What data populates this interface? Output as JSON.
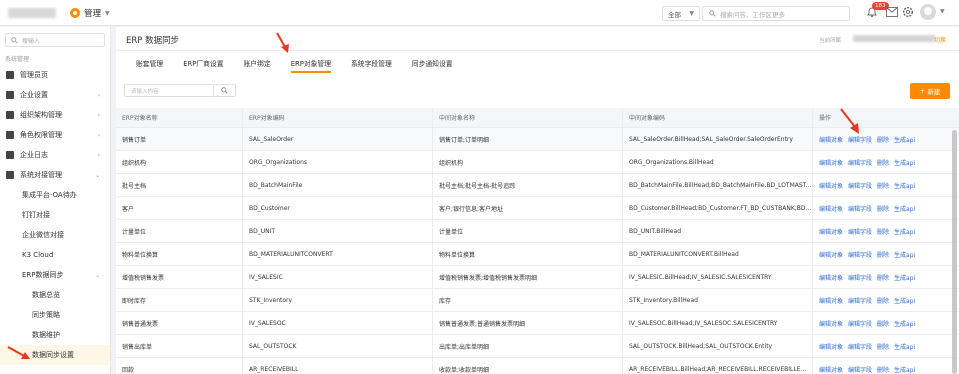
{
  "topbar": {
    "app_name": "管理",
    "search_scope": "全部",
    "search_placeholder": "搜索问答、工作区更多",
    "notification_count": "183"
  },
  "sidebar": {
    "search_placeholder": "搜输入",
    "section_label": "系统管理",
    "items": [
      {
        "label": "管理员页"
      },
      {
        "label": "企业设置"
      },
      {
        "label": "组织架构管理"
      },
      {
        "label": "角色权限管理"
      },
      {
        "label": "企业日志"
      },
      {
        "label": "系统对接管理"
      },
      {
        "label": "集成平台-OA待办"
      },
      {
        "label": "钉钉对接"
      },
      {
        "label": "企业微信对接"
      },
      {
        "label": "K3 Cloud"
      },
      {
        "label": "ERP数据同步"
      },
      {
        "label": "数据总览"
      },
      {
        "label": "同步策略"
      },
      {
        "label": "数据维护"
      },
      {
        "label": "数据同步设置"
      }
    ]
  },
  "main": {
    "title": "ERP 数据同步",
    "current_label": "当前所属",
    "switch_label": "切换",
    "tabs": [
      {
        "label": "账套管理"
      },
      {
        "label": "ERP厂商设置"
      },
      {
        "label": "账户绑定"
      },
      {
        "label": "ERP对象管理"
      },
      {
        "label": "系统字段管理"
      },
      {
        "label": "同步通知设置"
      }
    ],
    "filter_placeholder": "请输入内容",
    "add_button": "新建"
  },
  "table": {
    "headers": [
      "ERP对象名称",
      "ERP对象编码",
      "中间对象名称",
      "中间对象编码",
      "操作"
    ],
    "actions": [
      "编辑对象",
      "编辑字段",
      "删除",
      "生成api"
    ],
    "rows": [
      [
        "销售订单",
        "SAL_SaleOrder",
        "销售订单;订单明细",
        "SAL_SaleOrder.BillHead;SAL_SaleOrder.SaleOrderEntry"
      ],
      [
        "组织机构",
        "ORG_Organizations",
        "组织机构",
        "ORG_Organizations.BillHead"
      ],
      [
        "批号主档",
        "BD_BatchMainFile",
        "批号主档;批号主档-批号追踪",
        "BD_BatchMainFile.BillHead;BD_BatchMainFile.BD_LOTMAST..."
      ],
      [
        "客户",
        "BD_Customer",
        "客户;银行信息;客户地址",
        "BD_Customer.BillHead;BD_Customer.FT_BD_CUSTBANK;BD..."
      ],
      [
        "计量单位",
        "BD_UNIT",
        "计量单位",
        "BD_UNIT.BillHead"
      ],
      [
        "物料单位换算",
        "BD_MATERIALUNITCONVERT",
        "物料单位换算",
        "BD_MATERIALUNITCONVERT.BillHead"
      ],
      [
        "增值税销售发票",
        "IV_SALESIC",
        "增值税销售发票;增值税销售发票明细",
        "IV_SALESIC.BillHead;IV_SALESIC.SALESICENTRY"
      ],
      [
        "即时库存",
        "STK_Inventory",
        "库存",
        "STK_Inventory.BillHead"
      ],
      [
        "销售普通发票",
        "IV_SALESOC",
        "销售普通发票;普通销售发票明细",
        "IV_SALESOC.BillHead;IV_SALESOC.SALESICENTRY"
      ],
      [
        "销售出库单",
        "SAL_OUTSTOCK",
        "出库单;出库单明细",
        "SAL_OUTSTOCK.BillHead;SAL_OUTSTOCK.Entity"
      ],
      [
        "回款",
        "AR_RECEIVEBILL",
        "收款单;收款单明细",
        "AR_RECEIVEBILL.BillHead;AR_RECEIVEBILL.RECEIVEBILLE..."
      ]
    ]
  },
  "colors": {
    "accent": "#ff8a00",
    "link": "#2f6fd1",
    "annotation": "#e8361e"
  }
}
